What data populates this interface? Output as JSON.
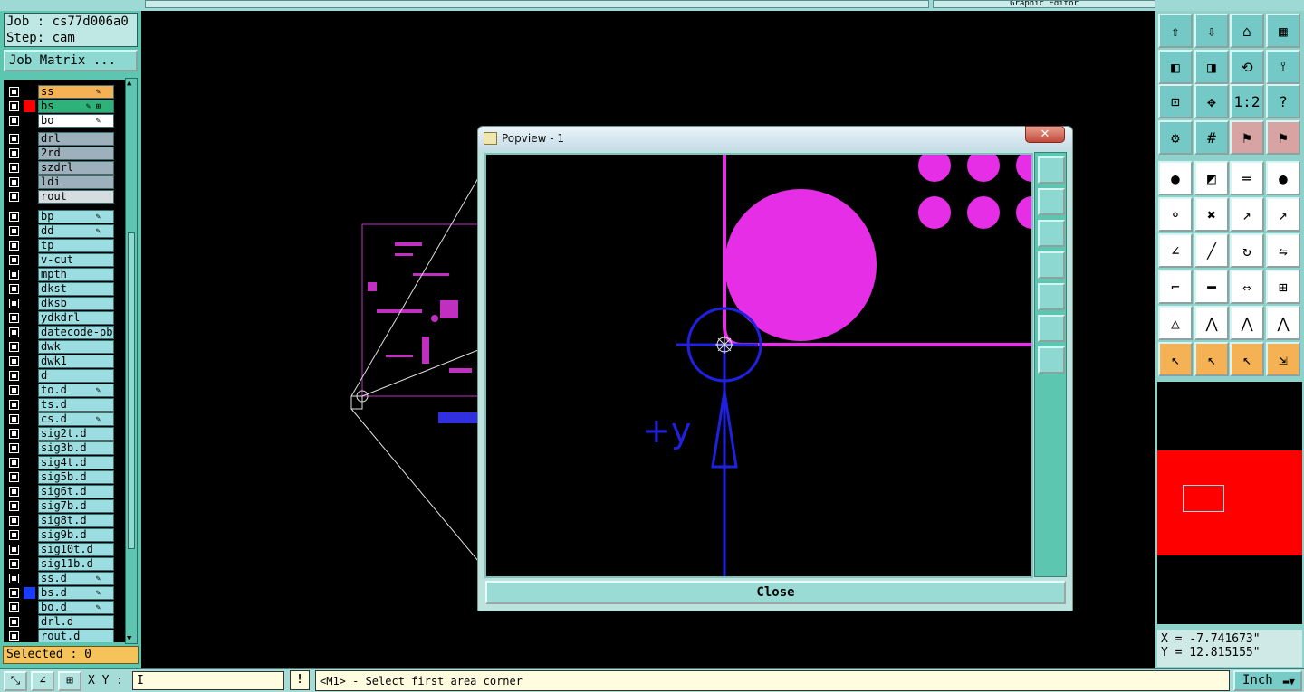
{
  "job": {
    "label": "Job : cs77d006a0",
    "step": "Step: cam",
    "matrix_button": "Job Matrix ..."
  },
  "layers": [
    {
      "name": "ss",
      "swatch": "",
      "bg": "#f4b254",
      "flag": "✎"
    },
    {
      "name": "bs",
      "swatch": "#ff0000",
      "bg": "#2fb27a",
      "flag": "✎ ⊞"
    },
    {
      "name": "bo",
      "swatch": "",
      "bg": "#ffffff",
      "flag": "✎"
    },
    {
      "name": "drl",
      "swatch": "",
      "bg": "#9fb0bd",
      "flag": ""
    },
    {
      "name": "2rd",
      "swatch": "",
      "bg": "#9fb0bd",
      "flag": ""
    },
    {
      "name": "szdrl",
      "swatch": "",
      "bg": "#9fb0bd",
      "flag": ""
    },
    {
      "name": "ldi",
      "swatch": "",
      "bg": "#9fb0bd",
      "flag": ""
    },
    {
      "name": "rout",
      "swatch": "",
      "bg": "#d6dde0",
      "flag": ""
    },
    {
      "name": "bp",
      "swatch": "",
      "bg": "#9bdde0",
      "flag": "✎"
    },
    {
      "name": "dd",
      "swatch": "",
      "bg": "#9bdde0",
      "flag": "✎"
    },
    {
      "name": "tp",
      "swatch": "",
      "bg": "#9bdde0",
      "flag": ""
    },
    {
      "name": "v-cut",
      "swatch": "",
      "bg": "#9bdde0",
      "flag": ""
    },
    {
      "name": "mpth",
      "swatch": "",
      "bg": "#9bdde0",
      "flag": ""
    },
    {
      "name": "dkst",
      "swatch": "",
      "bg": "#9bdde0",
      "flag": ""
    },
    {
      "name": "dksb",
      "swatch": "",
      "bg": "#9bdde0",
      "flag": ""
    },
    {
      "name": "ydkdrl",
      "swatch": "",
      "bg": "#9bdde0",
      "flag": ""
    },
    {
      "name": "datecode-pbe",
      "swatch": "",
      "bg": "#9bdde0",
      "flag": ""
    },
    {
      "name": "dwk",
      "swatch": "",
      "bg": "#9bdde0",
      "flag": ""
    },
    {
      "name": "dwk1",
      "swatch": "",
      "bg": "#9bdde0",
      "flag": ""
    },
    {
      "name": "d",
      "swatch": "",
      "bg": "#9bdde0",
      "flag": ""
    },
    {
      "name": "to.d",
      "swatch": "",
      "bg": "#9bdde0",
      "flag": "✎"
    },
    {
      "name": "ts.d",
      "swatch": "",
      "bg": "#9bdde0",
      "flag": ""
    },
    {
      "name": "cs.d",
      "swatch": "",
      "bg": "#9bdde0",
      "flag": "✎"
    },
    {
      "name": "sig2t.d",
      "swatch": "",
      "bg": "#9bdde0",
      "flag": ""
    },
    {
      "name": "sig3b.d",
      "swatch": "",
      "bg": "#9bdde0",
      "flag": ""
    },
    {
      "name": "sig4t.d",
      "swatch": "",
      "bg": "#9bdde0",
      "flag": ""
    },
    {
      "name": "sig5b.d",
      "swatch": "",
      "bg": "#9bdde0",
      "flag": ""
    },
    {
      "name": "sig6t.d",
      "swatch": "",
      "bg": "#9bdde0",
      "flag": ""
    },
    {
      "name": "sig7b.d",
      "swatch": "",
      "bg": "#9bdde0",
      "flag": ""
    },
    {
      "name": "sig8t.d",
      "swatch": "",
      "bg": "#9bdde0",
      "flag": ""
    },
    {
      "name": "sig9b.d",
      "swatch": "",
      "bg": "#9bdde0",
      "flag": ""
    },
    {
      "name": "sig10t.d",
      "swatch": "",
      "bg": "#9bdde0",
      "flag": ""
    },
    {
      "name": "sig11b.d",
      "swatch": "",
      "bg": "#9bdde0",
      "flag": ""
    },
    {
      "name": "ss.d",
      "swatch": "",
      "bg": "#9bdde0",
      "flag": "✎"
    },
    {
      "name": "bs.d",
      "swatch": "#1a3cff",
      "bg": "#9bdde0",
      "flag": "✎"
    },
    {
      "name": "bo.d",
      "swatch": "",
      "bg": "#9bdde0",
      "flag": "✎"
    },
    {
      "name": "drl.d",
      "swatch": "",
      "bg": "#9bdde0",
      "flag": ""
    },
    {
      "name": "rout.d",
      "swatch": "",
      "bg": "#9bdde0",
      "flag": ""
    }
  ],
  "selected": "Selected : 0",
  "popview": {
    "title": "Popview - 1",
    "close_label": "Close",
    "axis_label": "+y"
  },
  "toolbar_icons": [
    "zoom-home-icon",
    "zoom-prev-icon",
    "home-icon",
    "grid-window-icon",
    "pan-left-icon",
    "pan-right-icon",
    "pan-center-icon",
    "swap-icon",
    "fit-screen-icon",
    "zoom-fit-icon",
    "scale-1-2-icon",
    "help-icon",
    "settings-icon",
    "grid-icon",
    "layer-red-icon",
    "layer-compare-icon",
    "pad-icon",
    "measure-icon",
    "ruler-icon",
    "dot-icon",
    "net-icon",
    "cross-icon",
    "point-add-icon",
    "point-move-icon",
    "angle-icon",
    "line-icon",
    "rotate-icon",
    "mirror-icon",
    "snap-icon",
    "midline-icon",
    "dimension-icon",
    "group-icon",
    "triangle-icon",
    "triangle-up-icon",
    "arch-icon",
    "arch-measure-icon",
    "select-arrow-icon",
    "select-box-icon",
    "select-pad-icon",
    "select-net-icon"
  ],
  "coords": {
    "x": "X = -7.741673\"",
    "y": "Y = 12.815155\""
  },
  "status": {
    "xy_label": "X Y :",
    "xy_value": "I",
    "warn": "!",
    "message": "<M1> - Select first area corner",
    "unit": "Inch"
  },
  "top_title": "Graphic Editor"
}
